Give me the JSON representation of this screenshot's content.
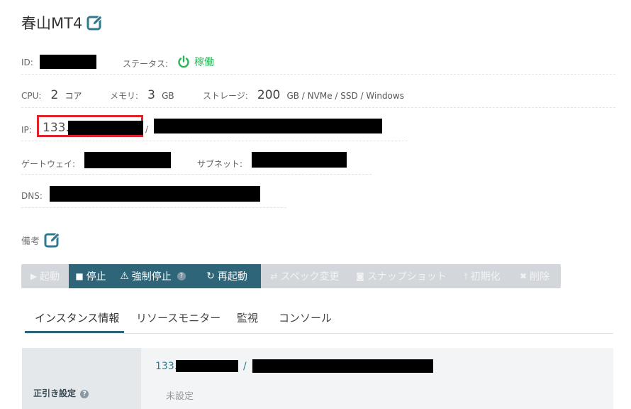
{
  "header": {
    "title": "春山MT4"
  },
  "info": {
    "id_label": "ID:",
    "status_label": "ステータス:",
    "status_value": "稼働",
    "cpu_label": "CPU:",
    "cpu_value": "2",
    "cpu_unit": "コア",
    "mem_label": "メモリ:",
    "mem_value": "3",
    "mem_unit": "GB",
    "storage_label": "ストレージ:",
    "storage_value": "200",
    "storage_unit": "GB / NVMe / SSD / Windows",
    "ip_label": "IP:",
    "ip_value": "133.",
    "ip_sep": "/",
    "gateway_label": "ゲートウェイ:",
    "subnet_label": "サブネット:",
    "dns_label": "DNS:"
  },
  "notes": {
    "label": "備考"
  },
  "toolbar": {
    "start": "起動",
    "stop": "停止",
    "force_stop": "強制停止",
    "restart": "再起動",
    "spec_change": "スペック変更",
    "snapshot": "スナップショット",
    "initialize": "初期化",
    "delete": "削除"
  },
  "tabs": {
    "instance_info": "インスタンス情報",
    "resource_monitor": "リソースモニター",
    "monitoring": "監視",
    "console": "コンソール"
  },
  "reverse_dns": {
    "label": "正引き設定",
    "ip_prefix": "133.",
    "sep": "/",
    "unset": "未設定"
  },
  "colors": {
    "accent": "#2f6578",
    "status_green": "#2db45a",
    "highlight_red": "#e0222a",
    "icon_teal": "#2f7a93"
  }
}
